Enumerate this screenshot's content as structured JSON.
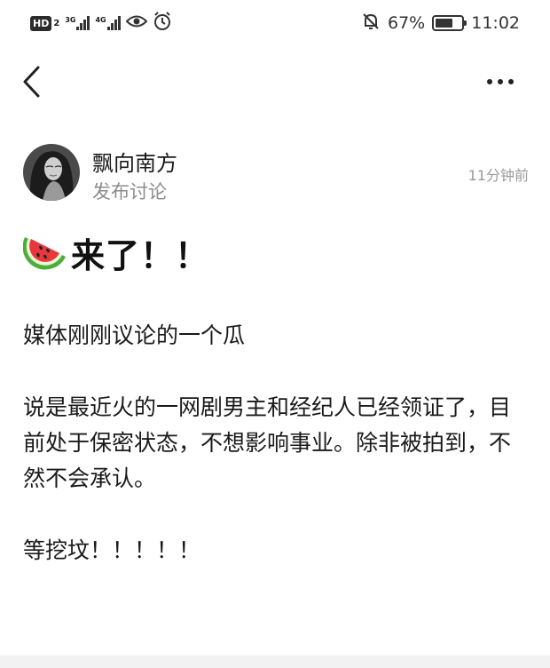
{
  "status_bar": {
    "hd_label": "HD",
    "hd_sub": "2",
    "net1_label": "3G",
    "net2_label": "4G",
    "battery_percent": "67%",
    "battery_level": 0.67,
    "time": "11:02",
    "icons": [
      "hd-icon",
      "signal-icon",
      "eye-icon",
      "alarm-icon",
      "bell-muted-icon",
      "battery-icon"
    ]
  },
  "nav": {
    "back_icon": "chevron-left-icon",
    "more_icon": "more-dots-icon"
  },
  "author": {
    "name": "飘向南方",
    "action": "发布讨论",
    "time": "11分钟前"
  },
  "post": {
    "title_emoji": "watermelon-icon",
    "title": "来了！！",
    "paragraphs": [
      "媒体刚刚议论的一个瓜",
      "说是最近火的一网剧男主和经纪人已经领证了，目前处于保密状态，不想影响事业。除非被拍到，不然不会承认。",
      "等挖坟！！！！！"
    ]
  },
  "colors": {
    "text": "#1a1a1a",
    "muted": "#8c8c8c",
    "watermelon_red": "#e8383d",
    "watermelon_green": "#4caf3a"
  }
}
